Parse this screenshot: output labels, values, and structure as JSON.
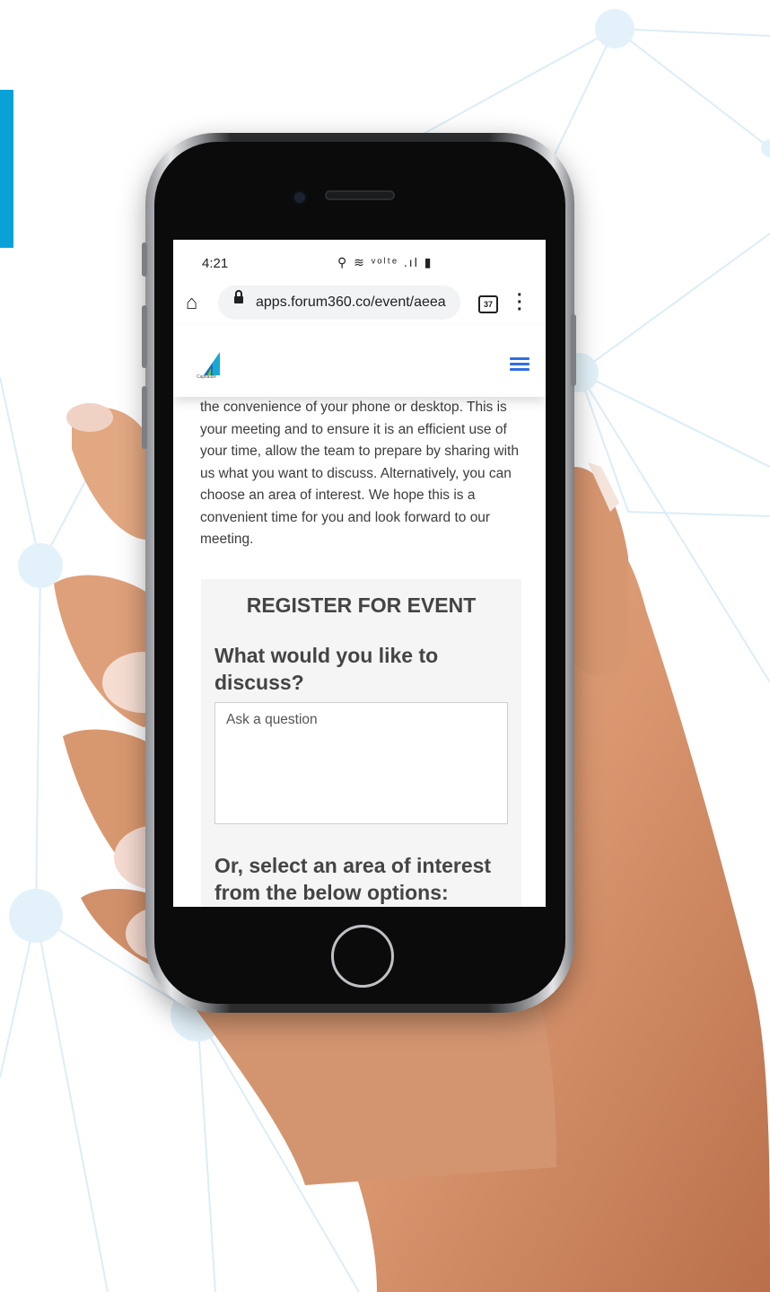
{
  "status_bar": {
    "time": "4:21",
    "icons": "⚲ ≋ ᵛᵒˡᵗᵉ .ıl ▮"
  },
  "browser": {
    "url": "apps.forum360.co/event/aeea",
    "tab_count": "37"
  },
  "site": {
    "logo_text": "Capitalize"
  },
  "intro": "the convenience of your phone or desktop. This is your meeting and to ensure it is an efficient use of your time, allow the team to prepare by sharing with us what you want to discuss. Alternatively, you can choose an area of interest. We hope this is a convenient time for you and look forward to our meeting.",
  "register": {
    "title": "REGISTER FOR EVENT",
    "question_heading": "What would you like to discuss?",
    "question_placeholder": "Ask a question",
    "interest_heading": "Or, select an area of interest from the below options:"
  },
  "colors": {
    "accent_bar": "#0aa0d8",
    "menu_blue": "#2f6fe0",
    "network_lines": "#d6ecf7"
  }
}
